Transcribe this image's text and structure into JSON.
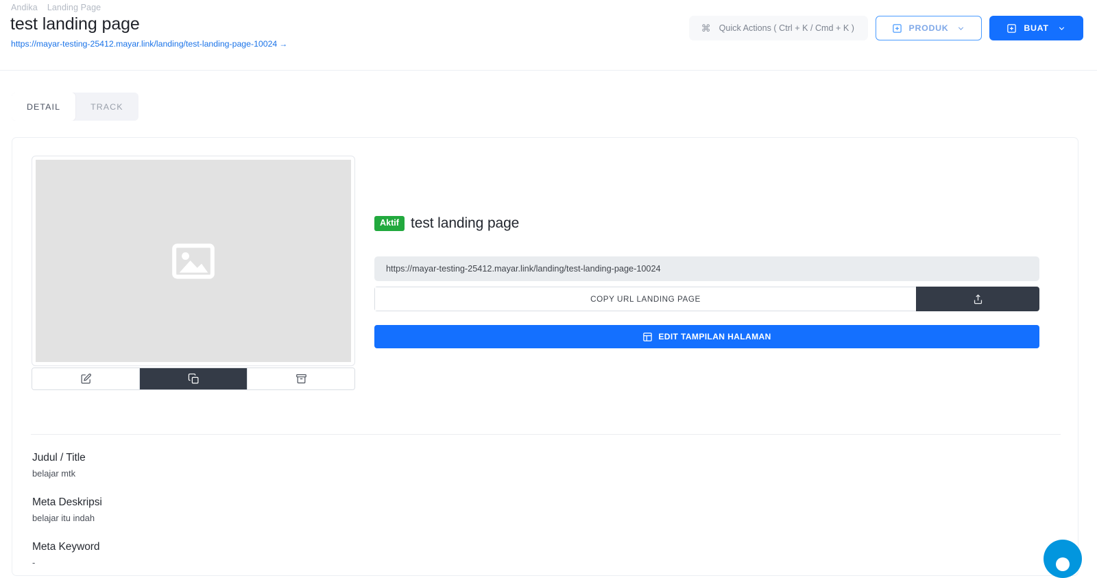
{
  "header": {
    "breadcrumb": [
      "Andika",
      "Landing Page"
    ],
    "title": "test landing page",
    "url": "https://mayar-testing-25412.mayar.link/landing/test-landing-page-10024",
    "url_arrow": "→",
    "quick_actions_label": "Quick Actions ( Ctrl + K / Cmd + K )",
    "cmd_icon": "command-icon",
    "produk_label": "PRODUK",
    "buat_label": "BUAT"
  },
  "tabs": [
    {
      "label": "DETAIL",
      "active": true
    },
    {
      "label": "TRACK",
      "active": false
    }
  ],
  "detail": {
    "thumbnail_icon": "image-placeholder-icon",
    "thumb_actions": [
      {
        "icon": "edit-pencil-icon",
        "active": false
      },
      {
        "icon": "duplicate-copy-icon",
        "active": true
      },
      {
        "icon": "archive-box-icon",
        "active": false
      }
    ],
    "status_badge": "Aktif",
    "landing_page_name": "test landing page",
    "url": "https://mayar-testing-25412.mayar.link/landing/test-landing-page-10024",
    "copy_url_label": "COPY URL LANDING PAGE",
    "share_icon": "share-upload-icon",
    "edit_page_label": "EDIT TAMPILAN HALAMAN",
    "edit_page_icon": "layout-panel-icon"
  },
  "meta": [
    {
      "label": "Judul / Title",
      "value": "belajar mtk"
    },
    {
      "label": "Meta Deskripsi",
      "value": "belajar itu indah"
    },
    {
      "label": "Meta Keyword",
      "value": "-"
    }
  ],
  "chat": {
    "icon": "chat-bubble-icon"
  },
  "colors": {
    "primary_blue": "#1470ff",
    "produk_border": "#4a9bff",
    "dark": "#343b47",
    "green": "#22a93e",
    "chat_blue": "#0296de",
    "url_link": "#1a73e8"
  }
}
